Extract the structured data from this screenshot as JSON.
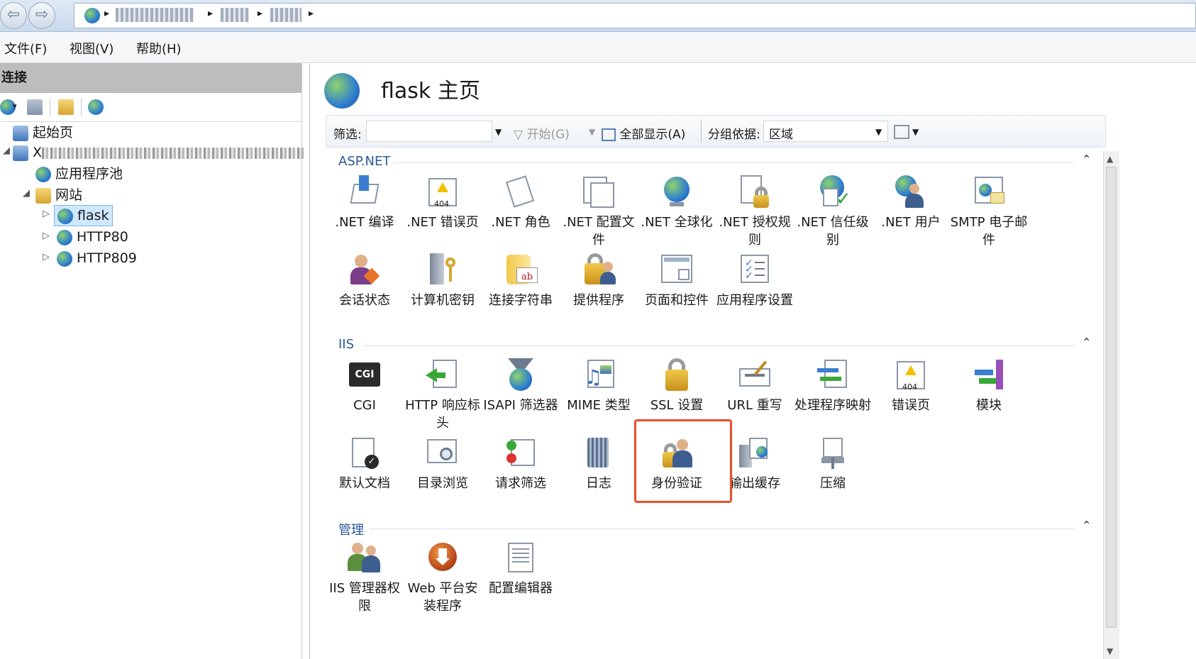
{
  "menu": {
    "file": "文件(F)",
    "view": "视图(V)",
    "help": "帮助(H)"
  },
  "connections": {
    "header": "连接",
    "tree": {
      "start_page": "起始页",
      "server": "X",
      "app_pools": "应用程序池",
      "sites": "网站",
      "site_flask": "flask",
      "site_http80": "HTTP80",
      "site_http809": "HTTP809"
    }
  },
  "main": {
    "title": "flask 主页",
    "filter": {
      "label": "筛选:",
      "go": "开始(G)",
      "show_all": "全部显示(A)",
      "group_by_label": "分组依据:",
      "group_by_value": "区域"
    },
    "groups": [
      {
        "name": "ASP.NET",
        "items": [
          {
            "label": ".NET 编译",
            "icon": "net-compile-icon"
          },
          {
            "label": ".NET 错误页",
            "icon": "net-error-page-icon"
          },
          {
            "label": ".NET 角色",
            "icon": "net-roles-icon"
          },
          {
            "label": ".NET 配置文件",
            "icon": "net-profile-icon"
          },
          {
            "label": ".NET 全球化",
            "icon": "net-globalization-icon"
          },
          {
            "label": ".NET 授权规则",
            "icon": "net-authorization-icon"
          },
          {
            "label": ".NET 信任级别",
            "icon": "net-trust-icon"
          },
          {
            "label": ".NET 用户",
            "icon": "net-users-icon"
          },
          {
            "label": "SMTP 电子邮件",
            "icon": "smtp-email-icon"
          },
          {
            "label": "会话状态",
            "icon": "session-state-icon"
          },
          {
            "label": "计算机密钥",
            "icon": "machine-key-icon"
          },
          {
            "label": "连接字符串",
            "icon": "connection-strings-icon"
          },
          {
            "label": "提供程序",
            "icon": "providers-icon"
          },
          {
            "label": "页面和控件",
            "icon": "pages-controls-icon"
          },
          {
            "label": "应用程序设置",
            "icon": "app-settings-icon"
          }
        ]
      },
      {
        "name": "IIS",
        "items": [
          {
            "label": "CGI",
            "icon": "cgi-icon"
          },
          {
            "label": "HTTP 响应标头",
            "icon": "http-headers-icon"
          },
          {
            "label": "ISAPI 筛选器",
            "icon": "isapi-filters-icon"
          },
          {
            "label": "MIME 类型",
            "icon": "mime-types-icon"
          },
          {
            "label": "SSL 设置",
            "icon": "ssl-settings-icon"
          },
          {
            "label": "URL 重写",
            "icon": "url-rewrite-icon"
          },
          {
            "label": "处理程序映射",
            "icon": "handler-mappings-icon"
          },
          {
            "label": "错误页",
            "icon": "error-pages-icon"
          },
          {
            "label": "模块",
            "icon": "modules-icon"
          },
          {
            "label": "默认文档",
            "icon": "default-document-icon"
          },
          {
            "label": "目录浏览",
            "icon": "directory-browsing-icon"
          },
          {
            "label": "请求筛选",
            "icon": "request-filtering-icon"
          },
          {
            "label": "日志",
            "icon": "logging-icon"
          },
          {
            "label": "身份验证",
            "icon": "authentication-icon"
          },
          {
            "label": "输出缓存",
            "icon": "output-caching-icon"
          },
          {
            "label": "压缩",
            "icon": "compression-icon"
          }
        ]
      },
      {
        "name": "管理",
        "items": [
          {
            "label": "IIS 管理器权限",
            "icon": "iis-manager-permissions-icon"
          },
          {
            "label": "Web 平台安装程序",
            "icon": "web-platform-installer-icon"
          },
          {
            "label": "配置编辑器",
            "icon": "configuration-editor-icon"
          }
        ]
      }
    ]
  },
  "colors": {
    "highlight_box": "#e8502a",
    "group_title": "#2b579a",
    "selection": "#cde8ff"
  }
}
